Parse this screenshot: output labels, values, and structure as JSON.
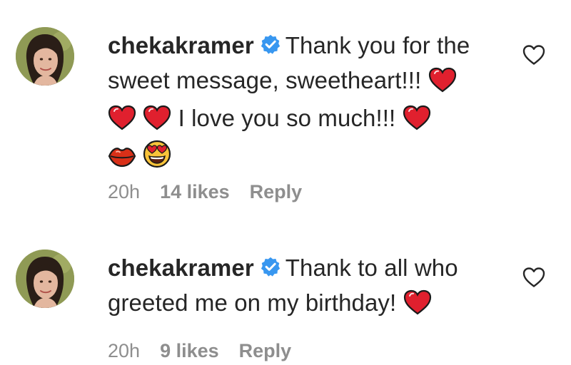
{
  "comments": [
    {
      "username": "chekakramer",
      "text_line1": "Thank you for the",
      "text_line2": "sweet message, sweetheart!!!",
      "text_line3": "I love you so much!!!",
      "emojis": [
        "red-heart",
        "red-heart",
        "red-heart",
        "red-heart",
        "kiss-lips",
        "heart-eyes"
      ],
      "time": "20h",
      "likes": "14 likes",
      "reply_label": "Reply"
    },
    {
      "username": "chekakramer",
      "text_line1": "Thank to all who",
      "text_line2": "greeted me on my birthday!",
      "emojis": [
        "red-heart"
      ],
      "time": "20h",
      "likes": "9 likes",
      "reply_label": "Reply"
    }
  ],
  "colors": {
    "text": "#262626",
    "meta": "#8e8e8e",
    "verified": "#3897f0",
    "heart": "#e0202e"
  }
}
